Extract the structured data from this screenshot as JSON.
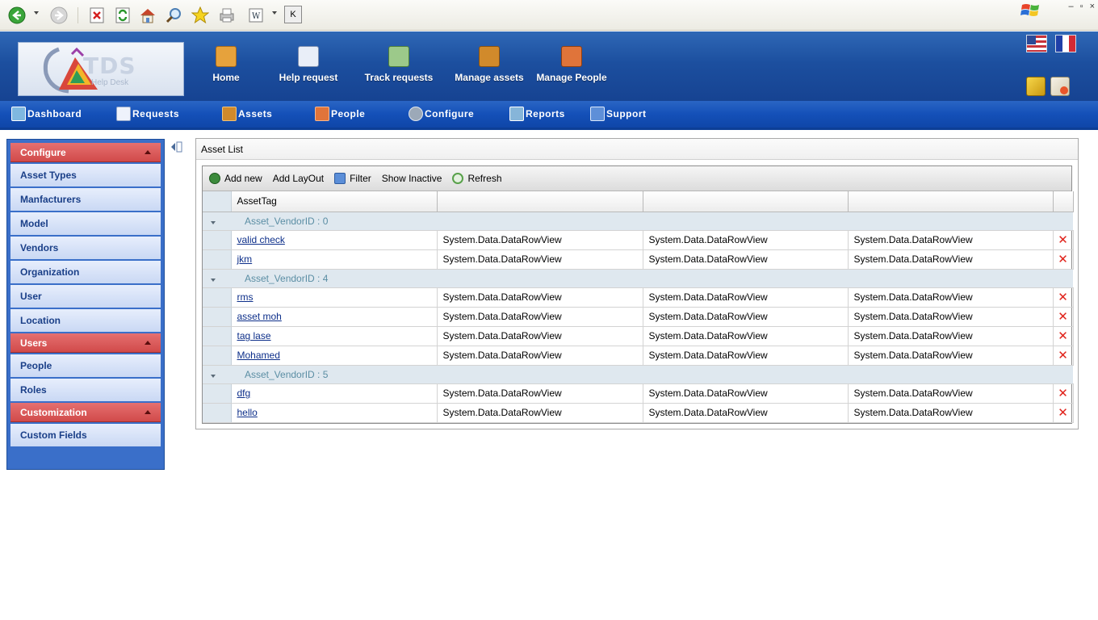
{
  "browser": {
    "buttons": [
      "back-icon",
      "forward-icon",
      "stop-icon",
      "refresh-icon",
      "home-icon",
      "search-icon",
      "favorites-icon",
      "print-icon",
      "edit-icon",
      "k-icon"
    ],
    "k_label": "K",
    "window_controls": [
      "–",
      "▫",
      "×"
    ]
  },
  "header": {
    "logo_text": "TDS",
    "logo_sub": "Help Desk",
    "items": [
      {
        "label": "Home",
        "icon": "home-icon",
        "color": "#e6a23c"
      },
      {
        "label": "Help request",
        "icon": "help-request-icon",
        "color": "#e9eef8"
      },
      {
        "label": "Track requests",
        "icon": "track-requests-icon",
        "color": "#9cc98a"
      },
      {
        "label": "Manage assets",
        "icon": "manage-assets-icon",
        "color": "#d18a2b"
      },
      {
        "label": "Manage People",
        "icon": "manage-people-icon",
        "color": "#e0743a"
      }
    ]
  },
  "nav": {
    "items": [
      {
        "label": "Dashboard",
        "icon": "dashboard-icon"
      },
      {
        "label": "Requests",
        "icon": "requests-icon"
      },
      {
        "label": "Assets",
        "icon": "assets-icon"
      },
      {
        "label": "People",
        "icon": "people-icon"
      },
      {
        "label": "Configure",
        "icon": "configure-icon"
      },
      {
        "label": "Reports",
        "icon": "reports-icon"
      },
      {
        "label": "Support",
        "icon": "support-icon"
      }
    ]
  },
  "sidebar": {
    "sections": [
      {
        "title": "Configure",
        "items": [
          "Asset Types",
          "Manfacturers",
          "Model",
          "Vendors",
          "Organization",
          "User",
          "Location"
        ]
      },
      {
        "title": "Users",
        "items": [
          "People",
          "Roles"
        ]
      },
      {
        "title": "Customization",
        "items": [
          "Custom Fields"
        ]
      }
    ]
  },
  "panel": {
    "title": "Asset List",
    "toolbar": {
      "add_new": "Add new",
      "add_layout": "Add LayOut",
      "filter": "Filter",
      "show_inactive": "Show Inactive",
      "refresh": "Refresh"
    },
    "columns": [
      "AssetTag",
      "",
      "",
      ""
    ],
    "groups": [
      {
        "label": "Asset_VendorID : 0",
        "rows": [
          {
            "tag": "valid check",
            "c2": "System.Data.DataRowView",
            "c3": "System.Data.DataRowView",
            "c4": "System.Data.DataRowView"
          },
          {
            "tag": "jkm",
            "c2": "System.Data.DataRowView",
            "c3": "System.Data.DataRowView",
            "c4": "System.Data.DataRowView"
          }
        ]
      },
      {
        "label": "Asset_VendorID : 4",
        "rows": [
          {
            "tag": "rms",
            "c2": "System.Data.DataRowView",
            "c3": "System.Data.DataRowView",
            "c4": "System.Data.DataRowView"
          },
          {
            "tag": "asset moh",
            "c2": "System.Data.DataRowView",
            "c3": "System.Data.DataRowView",
            "c4": "System.Data.DataRowView"
          },
          {
            "tag": "tag lase",
            "c2": "System.Data.DataRowView",
            "c3": "System.Data.DataRowView",
            "c4": "System.Data.DataRowView"
          },
          {
            "tag": "Mohamed",
            "c2": "System.Data.DataRowView",
            "c3": "System.Data.DataRowView",
            "c4": "System.Data.DataRowView"
          }
        ]
      },
      {
        "label": "Asset_VendorID : 5",
        "rows": [
          {
            "tag": "dfg",
            "c2": "System.Data.DataRowView",
            "c3": "System.Data.DataRowView",
            "c4": "System.Data.DataRowView"
          },
          {
            "tag": "hello",
            "c2": "System.Data.DataRowView",
            "c3": "System.Data.DataRowView",
            "c4": "System.Data.DataRowView"
          }
        ]
      }
    ],
    "delete_glyph": "✕"
  }
}
